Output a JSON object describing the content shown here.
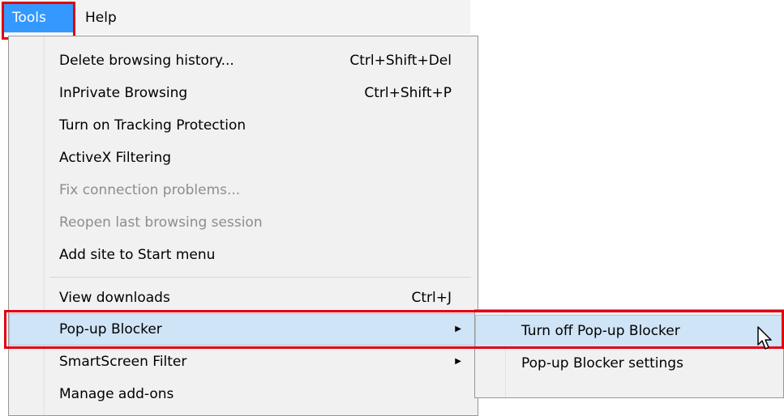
{
  "menubar": {
    "tools_label": "Tools",
    "help_label": "Help"
  },
  "dropdown": {
    "items": [
      {
        "label": "Delete browsing history...",
        "shortcut": "Ctrl+Shift+Del"
      },
      {
        "label": "InPrivate Browsing",
        "shortcut": "Ctrl+Shift+P"
      },
      {
        "label": "Turn on Tracking Protection"
      },
      {
        "label": "ActiveX Filtering"
      },
      {
        "label": "Fix connection problems...",
        "disabled": true
      },
      {
        "label": "Reopen last browsing session",
        "disabled": true
      },
      {
        "label": "Add site to Start menu"
      },
      {
        "label": "View downloads",
        "shortcut": "Ctrl+J"
      },
      {
        "label": "Pop-up Blocker",
        "submenu": true,
        "highlighted": true
      },
      {
        "label": "SmartScreen Filter",
        "submenu": true
      },
      {
        "label": "Manage add-ons"
      }
    ]
  },
  "submenu": {
    "items": [
      {
        "label": "Turn off Pop-up Blocker",
        "highlighted": true
      },
      {
        "label": "Pop-up Blocker settings"
      }
    ]
  },
  "colors": {
    "selected_menu": "#3399ff",
    "highlight_box": "#e3000f",
    "hover": "#cfe4f6"
  }
}
